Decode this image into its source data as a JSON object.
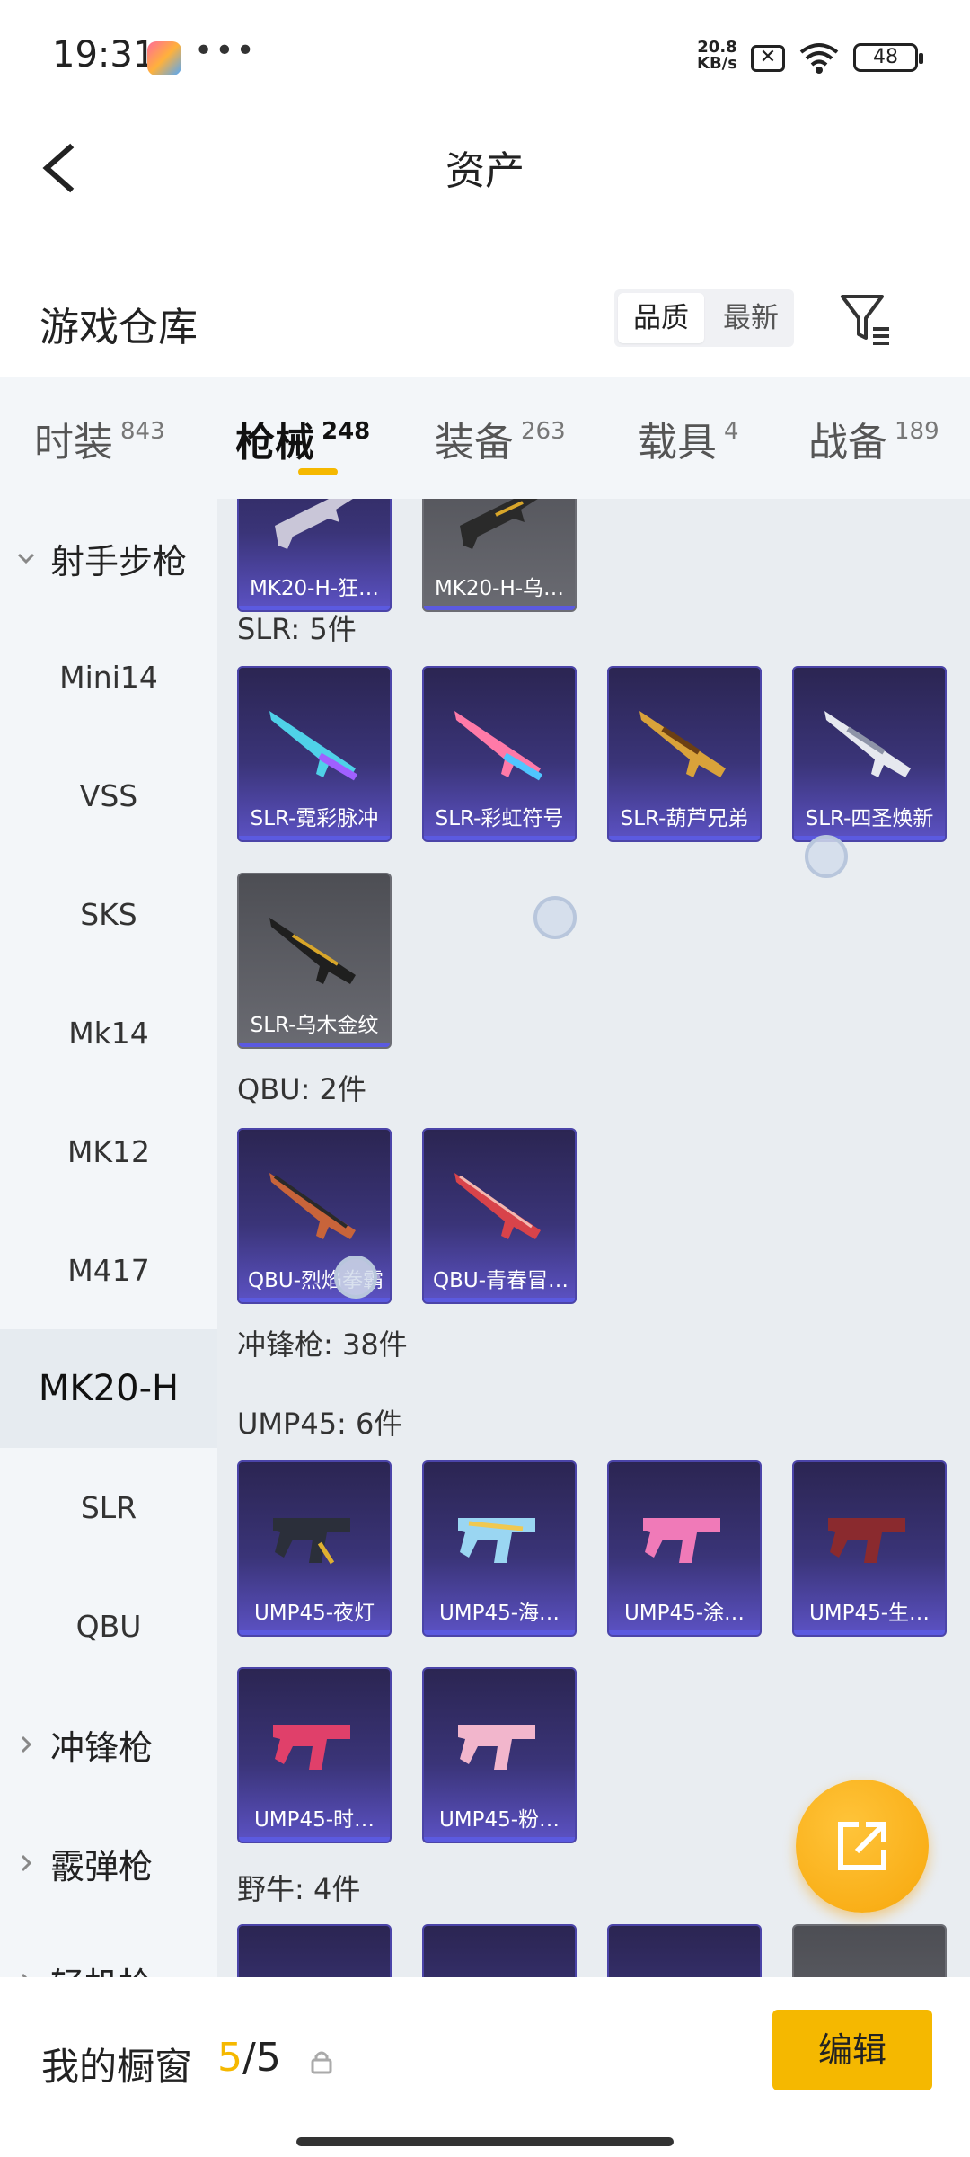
{
  "status": {
    "time": "19:31",
    "net_speed_value": "20.8",
    "net_speed_unit": "KB/s",
    "battery": "48"
  },
  "header": {
    "title": "资产"
  },
  "warehouse": {
    "title": "游戏仓库",
    "sort_options": [
      "品质",
      "最新"
    ],
    "sort_selected": "品质"
  },
  "tabs": [
    {
      "label": "时装",
      "count": "843"
    },
    {
      "label": "枪械",
      "count": "248"
    },
    {
      "label": "装备",
      "count": "263"
    },
    {
      "label": "载具",
      "count": "4"
    },
    {
      "label": "战备",
      "count": "189"
    }
  ],
  "sidebar": {
    "group_sniper": "射手步枪",
    "items": [
      "Mini14",
      "VSS",
      "SKS",
      "Mk14",
      "MK12",
      "M417",
      "MK20-H",
      "SLR",
      "QBU"
    ],
    "active": "MK20-H",
    "group_smg": "冲锋枪",
    "group_shotgun": "霰弹枪",
    "group_lmg": "轻机枪"
  },
  "content": {
    "mk20_cards": [
      "MK20-H-狂…",
      "MK20-H-乌…"
    ],
    "slr_title": "SLR: 5件",
    "slr_cards": [
      "SLR-霓彩脉冲",
      "SLR-彩虹符号",
      "SLR-葫芦兄弟",
      "SLR-四圣焕新",
      "SLR-乌木金纹"
    ],
    "qbu_title": "QBU: 2件",
    "qbu_cards": [
      "QBU-烈焰拳霸",
      "QBU-青春冒…"
    ],
    "smg_title": "冲锋枪: 38件",
    "ump_title": "UMP45: 6件",
    "ump_cards": [
      "UMP45-夜灯",
      "UMP45-海…",
      "UMP45-涂…",
      "UMP45-生…",
      "UMP45-时…",
      "UMP45-粉…"
    ],
    "bizon_title": "野牛: 4件"
  },
  "bottom": {
    "window_label": "我的橱窗",
    "current": "5",
    "total": "/5",
    "edit": "编辑"
  },
  "colors": {
    "accent": "#f5b800",
    "card_purple": "#3a3478",
    "sidebar_bg": "#f3f6f9"
  }
}
